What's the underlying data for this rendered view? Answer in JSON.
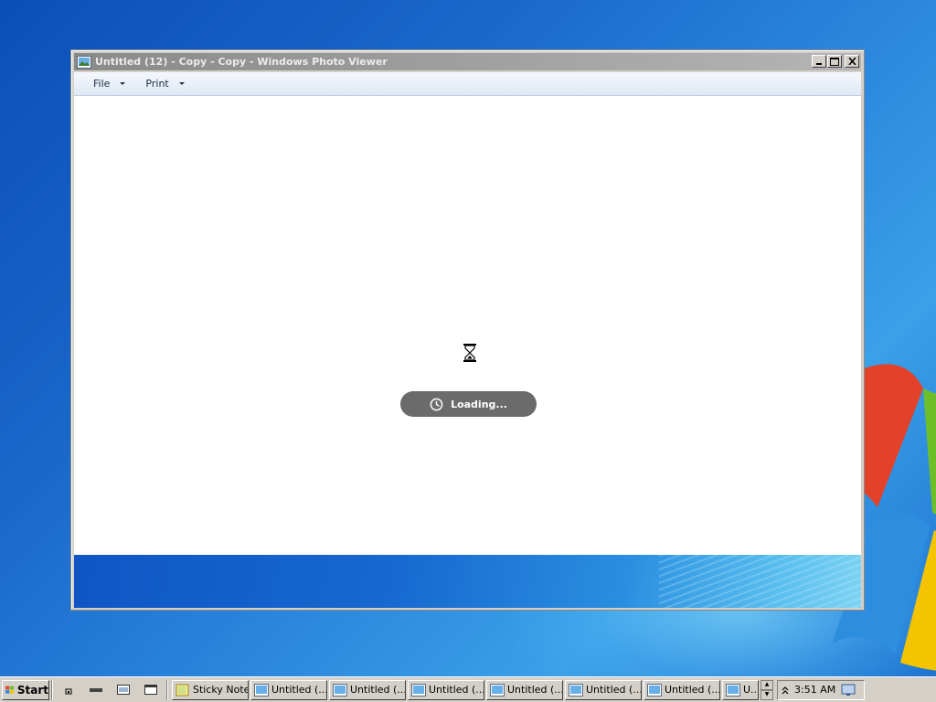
{
  "window": {
    "title": "Untitled (12) - Copy - Copy - Windows Photo Viewer",
    "minimize_icon": "minimize-icon",
    "maximize_icon": "maximize-icon",
    "close_icon": "close-icon"
  },
  "menubar": {
    "file_label": "File",
    "print_label": "Print"
  },
  "viewer": {
    "loading_label": "Loading...",
    "busy_icon": "hourglass-icon",
    "clock_icon": "clock-icon"
  },
  "taskbar": {
    "start_label": "Start",
    "tasks": [
      {
        "label": "Sticky Notes",
        "icon": "sticky-notes-icon"
      },
      {
        "label": "Untitled (...",
        "icon": "photo-viewer-icon"
      },
      {
        "label": "Untitled (...",
        "icon": "photo-viewer-icon"
      },
      {
        "label": "Untitled (...",
        "icon": "photo-viewer-icon"
      },
      {
        "label": "Untitled (...",
        "icon": "photo-viewer-icon"
      },
      {
        "label": "Untitled (...",
        "icon": "photo-viewer-icon"
      },
      {
        "label": "Untitled (...",
        "icon": "photo-viewer-icon"
      },
      {
        "label": "U...",
        "icon": "photo-viewer-icon"
      }
    ],
    "clock": "3:51 AM"
  }
}
